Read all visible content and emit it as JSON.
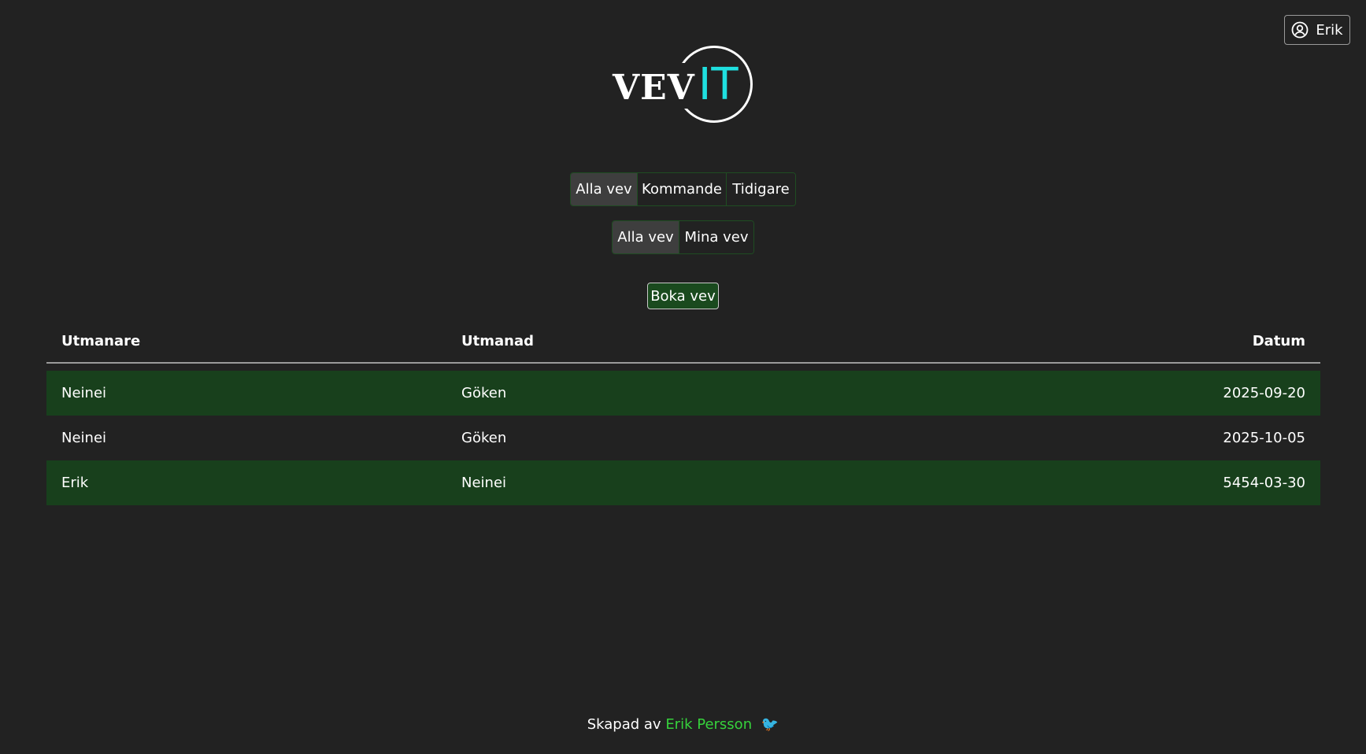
{
  "user": {
    "name": "Erik",
    "icon": "user-circle-icon"
  },
  "logo": {
    "part1": "VEV",
    "part2": "IT",
    "accent": "#1fe0e0"
  },
  "filters": {
    "time": {
      "options": [
        "Alla vev",
        "Kommande",
        "Tidigare"
      ],
      "selected": "Alla vev"
    },
    "owner": {
      "options": [
        "Alla vev",
        "Mina vev"
      ],
      "selected": "Alla vev"
    }
  },
  "book_button": {
    "label": "Boka vev"
  },
  "table": {
    "headers": [
      "Utmanare",
      "Utmanad",
      "Datum"
    ],
    "rows": [
      {
        "challenger": "Neinei",
        "challenged": "Göken",
        "date": "2025-09-20"
      },
      {
        "challenger": "Neinei",
        "challenged": "Göken",
        "date": "2025-10-05"
      },
      {
        "challenger": "Erik",
        "challenged": "Neinei",
        "date": "5454-03-30"
      }
    ]
  },
  "footer": {
    "prefix": "Skapad av",
    "author": "Erik Persson",
    "emoji": "🐦",
    "accent": "#36d23c"
  },
  "colors": {
    "background": "#222222",
    "row_highlight": "#18401c",
    "button_green": "#1a4a1e"
  }
}
